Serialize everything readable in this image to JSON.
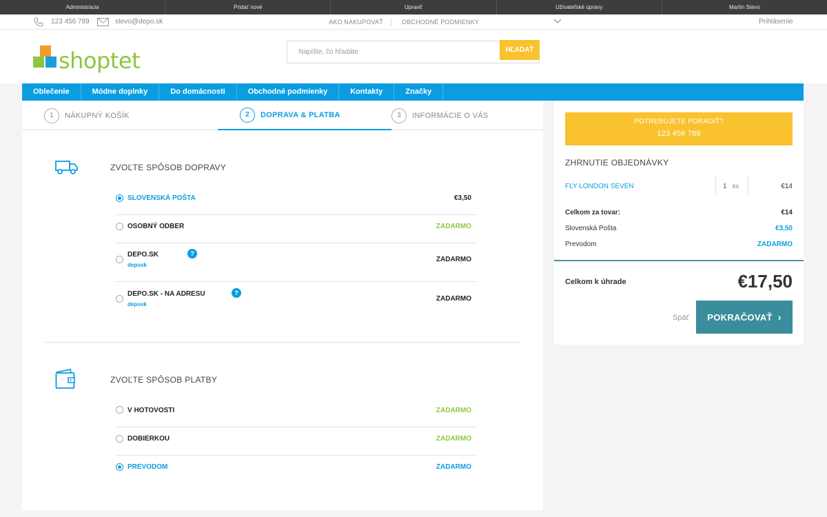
{
  "admin_bar": {
    "items": [
      "Administrácia",
      "Pridať nové",
      "Upraviť",
      "Užívateľské úpravy",
      "Martin Stevo"
    ]
  },
  "top_info": {
    "phone": "123 456 789",
    "email": "stevo@depo.sk",
    "link_how_to_buy": "AKO NAKUPOVAŤ",
    "link_terms": "OBCHODNÉ PODMIENKY",
    "login": "Prihlásenie"
  },
  "header": {
    "logo_text": "shoptet",
    "search_placeholder": "Napíšte, čo hľadáte",
    "search_button": "HĽADAŤ"
  },
  "nav": {
    "items": [
      "Oblečenie",
      "Módne doplnky",
      "Do domácnosti",
      "Obchodné podmienky",
      "Kontakty",
      "Značky"
    ]
  },
  "steps": [
    {
      "num": "1",
      "label": "NÁKUPNÝ KOŠÍK"
    },
    {
      "num": "2",
      "label": "DOPRAVA & PLATBA"
    },
    {
      "num": "3",
      "label": "INFORMÁCIE O VÁS"
    }
  ],
  "shipping": {
    "title": "ZVOĽTE SPÔSOB DOPRAVY",
    "options": [
      {
        "label": "SLOVENSKÁ POŠTA",
        "price": "€3,50",
        "selected": true
      },
      {
        "label": "OSOBNÝ ODBER",
        "price": "ZADARMO",
        "selected": false
      },
      {
        "label": "DEPO.SK",
        "sub": "deposk",
        "help": "?",
        "price": "ZADARMO",
        "selected": false
      },
      {
        "label": "DEPO.SK - NA ADRESU",
        "sub": "deposk",
        "help": "?",
        "price": "ZADARMO",
        "selected": false
      }
    ]
  },
  "payment": {
    "title": "ZVOĽTE SPÔSOB PLATBY",
    "options": [
      {
        "label": "V HOTOVOSTI",
        "price": "ZADARMO",
        "selected": false
      },
      {
        "label": "DOBIERKOU",
        "price": "ZADARMO",
        "selected": false
      },
      {
        "label": "PREVODOM",
        "price": "ZADARMO",
        "selected": true
      }
    ]
  },
  "sidebar": {
    "advice_title": "POTREBUJETE PORADIŤ?",
    "advice_phone": "123 456 789",
    "summary_title": "ZHRNUTIE OBJEDNÁVKY",
    "item": {
      "name": "FLY LONDON SEVEN",
      "qty": "1",
      "unit": "ks",
      "price": "€14"
    },
    "lines": [
      {
        "label": "Celkom za tovar:",
        "value": "€14"
      },
      {
        "label": "Slovenská Pošta",
        "value": "€3,50"
      },
      {
        "label": "Prevodom",
        "value": "ZADARMO"
      }
    ],
    "total_label": "Celkom k úhrade",
    "total_value": "€17,50",
    "back": "Späť",
    "continue": "POKRAČOVAŤ"
  },
  "colors": {
    "brand_blue": "#0b9de0",
    "accent_yellow": "#f9c22e",
    "free_green": "#8dc63f",
    "continue_teal": "#3a8d9c"
  }
}
